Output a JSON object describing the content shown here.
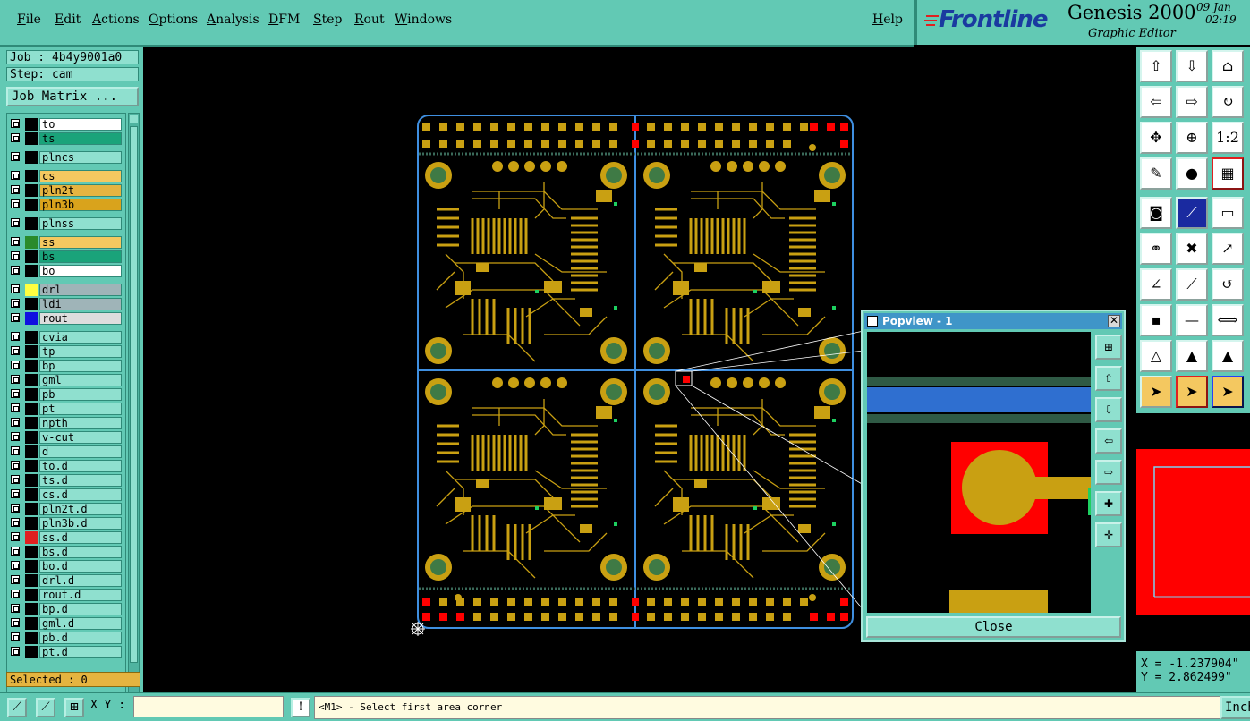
{
  "menu": [
    "File",
    "Edit",
    "Actions",
    "Options",
    "Analysis",
    "DFM",
    "Step",
    "Rout",
    "Windows"
  ],
  "help": "Help",
  "brand": {
    "logo": "Frontline",
    "product": "Genesis 2000",
    "subtitle": "Graphic Editor",
    "date": "09 Jan",
    "time": "02:19"
  },
  "job": {
    "job_line": "Job : 4b4y9001a0",
    "step_line": "Step: cam",
    "matrix_button": "Job Matrix ..."
  },
  "layers": [
    {
      "name": "to",
      "bg": "#ffffff",
      "swatch": "#000000"
    },
    {
      "name": "ts",
      "bg": "#1aa37a",
      "swatch": "#000000"
    },
    {
      "name": "plncs",
      "bg": "#8fe0cf",
      "swatch": "#000000"
    },
    {
      "name": "cs",
      "bg": "#f4c860",
      "swatch": "#000000"
    },
    {
      "name": "pln2t",
      "bg": "#e5b440",
      "swatch": "#000000"
    },
    {
      "name": "pln3b",
      "bg": "#d9a31c",
      "swatch": "#000000"
    },
    {
      "name": "plnss",
      "bg": "#8fe0cf",
      "swatch": "#000000"
    },
    {
      "name": "ss",
      "bg": "#f4c860",
      "swatch": "#2a8a2a"
    },
    {
      "name": "bs",
      "bg": "#1aa37a",
      "swatch": "#000000"
    },
    {
      "name": "bo",
      "bg": "#ffffff",
      "swatch": "#000000"
    },
    {
      "name": "drl",
      "bg": "#9fb4b8",
      "swatch": "#ffff40"
    },
    {
      "name": "ldi",
      "bg": "#9fb4b8",
      "swatch": "#000000"
    },
    {
      "name": "rout",
      "bg": "#dddddd",
      "swatch": "#1010e0"
    },
    {
      "name": "cvia",
      "bg": "#8fe0cf",
      "swatch": "#000000"
    },
    {
      "name": "tp",
      "bg": "#8fe0cf",
      "swatch": "#000000"
    },
    {
      "name": "bp",
      "bg": "#8fe0cf",
      "swatch": "#000000"
    },
    {
      "name": "gml",
      "bg": "#8fe0cf",
      "swatch": "#000000"
    },
    {
      "name": "pb",
      "bg": "#8fe0cf",
      "swatch": "#000000"
    },
    {
      "name": "pt",
      "bg": "#8fe0cf",
      "swatch": "#000000"
    },
    {
      "name": "npth",
      "bg": "#8fe0cf",
      "swatch": "#000000"
    },
    {
      "name": "v-cut",
      "bg": "#8fe0cf",
      "swatch": "#000000"
    },
    {
      "name": "d",
      "bg": "#8fe0cf",
      "swatch": "#000000"
    },
    {
      "name": "to.d",
      "bg": "#8fe0cf",
      "swatch": "#000000"
    },
    {
      "name": "ts.d",
      "bg": "#8fe0cf",
      "swatch": "#000000"
    },
    {
      "name": "cs.d",
      "bg": "#8fe0cf",
      "swatch": "#000000"
    },
    {
      "name": "pln2t.d",
      "bg": "#8fe0cf",
      "swatch": "#000000"
    },
    {
      "name": "pln3b.d",
      "bg": "#8fe0cf",
      "swatch": "#000000"
    },
    {
      "name": "ss.d",
      "bg": "#8fe0cf",
      "swatch": "#e02020"
    },
    {
      "name": "bs.d",
      "bg": "#8fe0cf",
      "swatch": "#000000"
    },
    {
      "name": "bo.d",
      "bg": "#8fe0cf",
      "swatch": "#000000"
    },
    {
      "name": "drl.d",
      "bg": "#8fe0cf",
      "swatch": "#000000"
    },
    {
      "name": "rout.d",
      "bg": "#8fe0cf",
      "swatch": "#000000"
    },
    {
      "name": "bp.d",
      "bg": "#8fe0cf",
      "swatch": "#000000"
    },
    {
      "name": "gml.d",
      "bg": "#8fe0cf",
      "swatch": "#000000"
    },
    {
      "name": "pb.d",
      "bg": "#8fe0cf",
      "swatch": "#000000"
    },
    {
      "name": "pt.d",
      "bg": "#8fe0cf",
      "swatch": "#000000"
    }
  ],
  "selected": "Selected : 0",
  "bottom": {
    "xy_label": "X Y :",
    "xy_value": "",
    "prompt": "<M1> - Select first area corner",
    "units_button": "Inch"
  },
  "popview": {
    "title": "Popview - 1",
    "close": "Close"
  },
  "coords": {
    "x": "X = -1.237904\"",
    "y": "Y = 2.862499\""
  },
  "colors": {
    "panel": "#62c9b4",
    "copper": "#c9a012",
    "pad_red": "#ff0000",
    "outline_blue": "#3f8fe0"
  }
}
